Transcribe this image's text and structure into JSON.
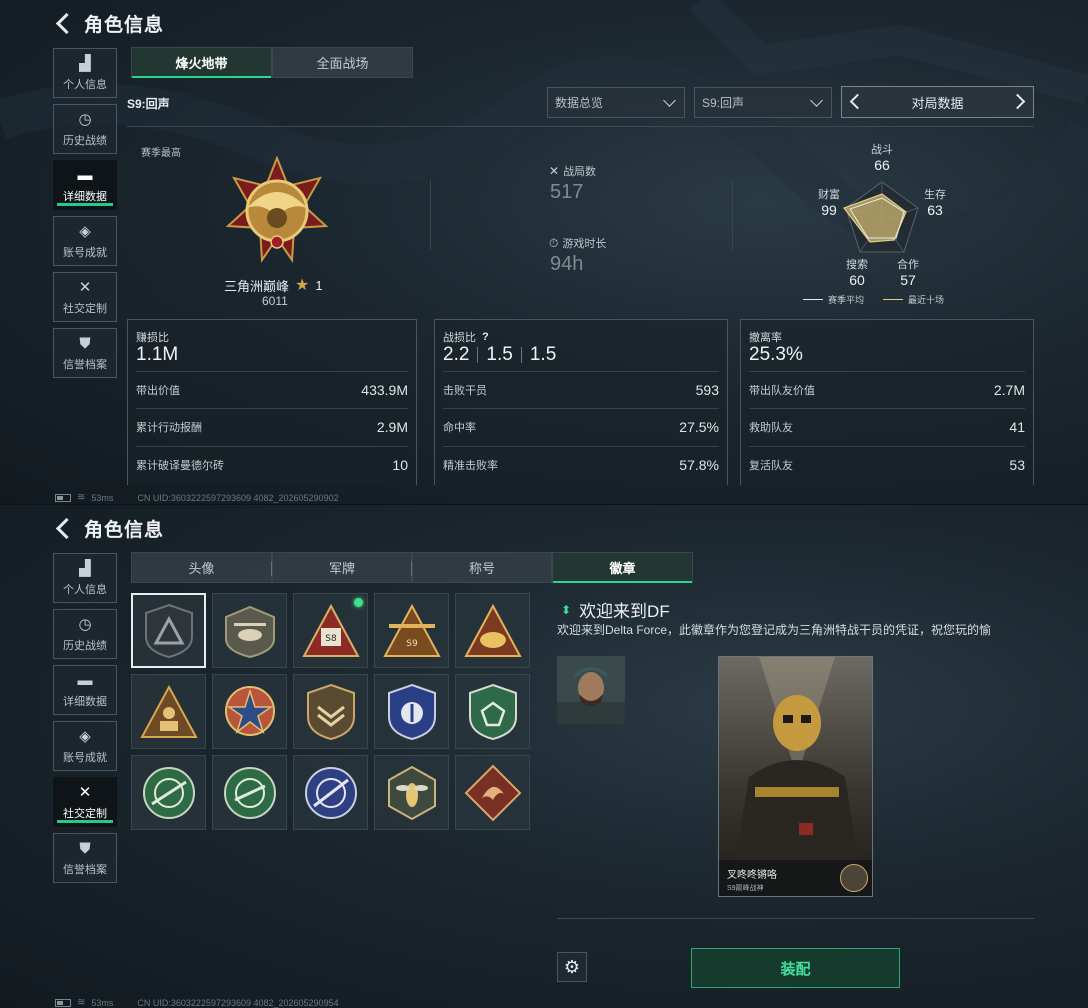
{
  "header": {
    "title": "角色信息"
  },
  "sidebar": {
    "items": [
      {
        "label": "个人信息",
        "icon": "bar-chart-icon"
      },
      {
        "label": "历史战绩",
        "icon": "clock-icon"
      },
      {
        "label": "详细数据",
        "icon": "folder-icon"
      },
      {
        "label": "账号成就",
        "icon": "medal-icon"
      },
      {
        "label": "社交定制",
        "icon": "tools-icon"
      },
      {
        "label": "信誉档案",
        "icon": "shield-icon"
      }
    ]
  },
  "screen1": {
    "tabs": [
      "烽火地带",
      "全面战场"
    ],
    "season_label": "S9:回声",
    "dropdowns": [
      "数据总览",
      "S9:回声"
    ],
    "pager_label": "对局数据",
    "rank": {
      "caption": "赛季最高",
      "name": "三角洲巅峰",
      "stars": "1",
      "score": "6011"
    },
    "matches": {
      "label": "战局数",
      "value": "517"
    },
    "playtime": {
      "label": "游戏时长",
      "value": "94h"
    },
    "radar": {
      "axes": [
        {
          "name": "战斗",
          "value": "66"
        },
        {
          "name": "生存",
          "value": "63"
        },
        {
          "name": "合作",
          "value": "57"
        },
        {
          "name": "搜索",
          "value": "60"
        },
        {
          "name": "财富",
          "value": "99"
        }
      ],
      "legend": [
        "赛季平均",
        "最近十场"
      ]
    },
    "cards": [
      {
        "title": "赚损比",
        "value": "1.1M",
        "rows": [
          {
            "label": "带出价值",
            "value": "433.9M"
          },
          {
            "label": "累计行动报酬",
            "value": "2.9M"
          },
          {
            "label": "累计破译曼德尔砖",
            "value": "10"
          }
        ]
      },
      {
        "title": "战损比",
        "value_parts": [
          "2.2",
          "1.5",
          "1.5"
        ],
        "help": "?",
        "rows": [
          {
            "label": "击败干员",
            "value": "593"
          },
          {
            "label": "命中率",
            "value": "27.5%"
          },
          {
            "label": "精准击败率",
            "value": "57.8%"
          }
        ]
      },
      {
        "title": "撤离率",
        "value": "25.3%",
        "rows": [
          {
            "label": "带出队友价值",
            "value": "2.7M"
          },
          {
            "label": "救助队友",
            "value": "41"
          },
          {
            "label": "复活队友",
            "value": "53"
          }
        ]
      }
    ],
    "footer": {
      "ping": "53ms",
      "uid": "CN UID:3603222597293609 4082_202605290902"
    }
  },
  "screen2": {
    "tabs": [
      "头像",
      "军牌",
      "称号",
      "徽章"
    ],
    "badge_title": "欢迎来到DF",
    "badge_desc": "欢迎来到Delta Force，此徽章作为您登记成为三角洲特战干员的凭证，祝您玩的愉",
    "preview": {
      "name": "叉咚咚锵咯",
      "sub": "S9巅峰战神"
    },
    "equip_label": "装配",
    "footer": {
      "ping": "53ms",
      "uid": "CN UID:3603222597293609 4082_202605290954"
    }
  }
}
